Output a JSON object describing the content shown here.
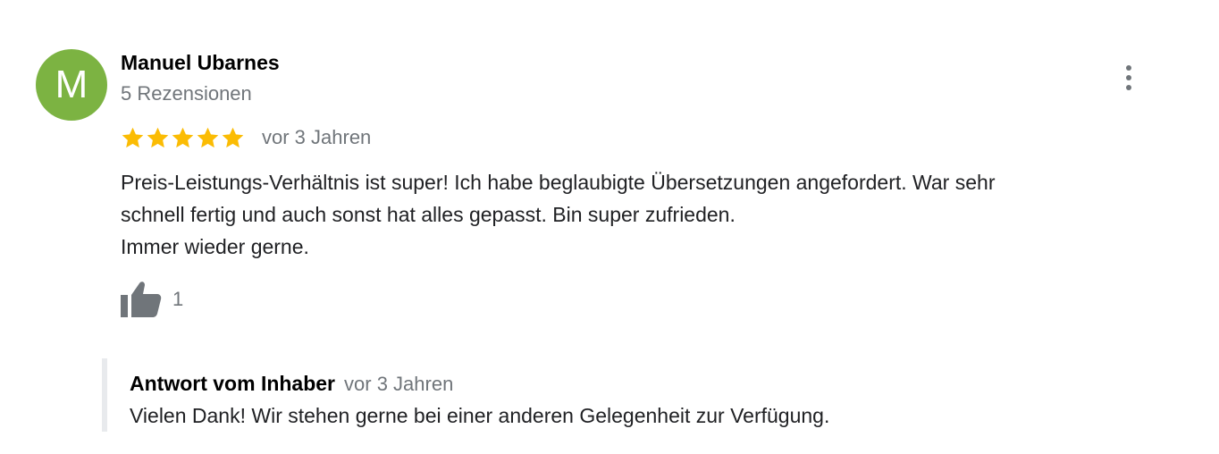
{
  "review": {
    "avatar": {
      "letter": "M",
      "color": "#7cb342"
    },
    "author_name": "Manuel Ubarnes",
    "review_count": "5 Rezensionen",
    "rating": 5,
    "rating_max": 5,
    "star_color": "#fbbc04",
    "date": "vor 3 Jahren",
    "text_lines": [
      "Preis-Leistungs-Verhältnis ist super! Ich habe beglaubigte Übersetzungen angefordert. War sehr",
      "schnell fertig und auch sonst hat alles gepasst. Bin super zufrieden.",
      "Immer wieder gerne."
    ],
    "likes": "1",
    "menu_icon": "more-vert-icon",
    "like_icon": "thumbs-up-icon"
  },
  "owner_reply": {
    "author": "Antwort vom Inhaber",
    "date": "vor 3 Jahren",
    "text": "Vielen Dank! Wir stehen gerne bei einer anderen Gelegenheit zur Verfügung."
  }
}
